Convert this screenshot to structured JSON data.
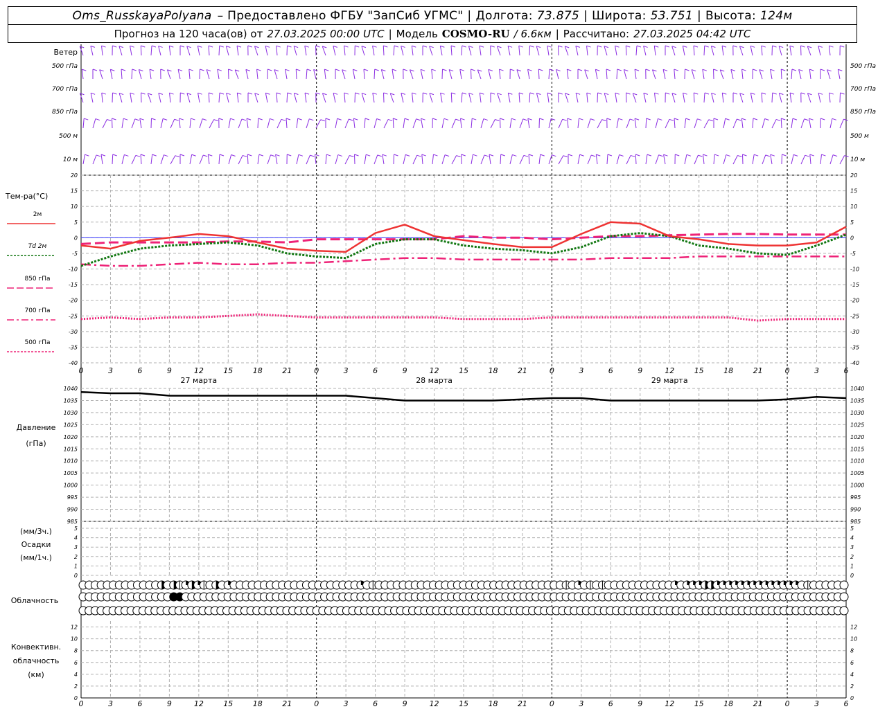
{
  "header": {
    "station": "Oms_RusskayaPolyana",
    "provided": "– Предоставлено ФГБУ \"ЗапСиб УГМС\"",
    "lon_label": "Долгота:",
    "lon": "73.875",
    "lat_label": "Широта:",
    "lat": "53.751",
    "alt_label": "Высота:",
    "alt": "124м",
    "forecast_label": "Прогноз на 120 часа(ов) от",
    "forecast_start": "27.03.2025 00:00 UTC",
    "model_label": "Модель",
    "model": "COSMO-RU",
    "resolution": "/ 6.6км",
    "calc_label": "Рассчитано:",
    "calc_time": "27.03.2025 04:42 UTC"
  },
  "chart_data": [
    {
      "type": "wind_barbs",
      "title": "Ветер",
      "levels": [
        "500 гПа",
        "700 гПа",
        "850 гПа",
        "500 м",
        "10 м"
      ]
    },
    {
      "type": "line",
      "ylabel": "Тем-ра(°C)",
      "ylim": [
        -40,
        20
      ],
      "yticks": [
        20,
        15,
        10,
        5,
        0,
        -5,
        -10,
        -15,
        -20,
        -25,
        -30,
        -35,
        -40
      ],
      "x_hours": [
        0,
        3,
        6,
        9,
        12,
        15,
        18,
        21,
        24,
        27,
        30,
        33,
        36,
        39,
        42,
        45,
        48,
        51,
        54,
        57,
        60,
        63,
        66,
        69,
        72,
        75,
        78
      ],
      "series": [
        {
          "name": "2м",
          "color": "#ee3333",
          "style": "solid",
          "values": [
            -2.5,
            -3.5,
            -1.0,
            0.0,
            1.2,
            0.5,
            -1.5,
            -3.5,
            -4.2,
            -4.5,
            1.5,
            4.2,
            0.5,
            -0.8,
            -2.0,
            -3.0,
            -3.0,
            1.2,
            5.0,
            4.5,
            0.5,
            -0.5,
            -2.0,
            -2.5,
            -2.5,
            -1.5,
            3.5
          ]
        },
        {
          "name": "Td 2м",
          "color": "#117711",
          "style": "dotted",
          "values": [
            -9.0,
            -6.0,
            -3.5,
            -2.5,
            -2.0,
            -1.5,
            -2.5,
            -5.0,
            -6.0,
            -6.5,
            -2.0,
            -0.5,
            -0.5,
            -2.5,
            -3.5,
            -4.0,
            -5.0,
            -3.0,
            0.5,
            1.5,
            0.5,
            -2.5,
            -3.5,
            -5.0,
            -5.5,
            -2.5,
            1.0
          ]
        },
        {
          "name": "850 гПа",
          "color": "#ee2277",
          "style": "dashed",
          "values": [
            -2.0,
            -1.5,
            -1.5,
            -1.5,
            -1.5,
            -1.2,
            -1.2,
            -1.5,
            -0.5,
            -0.5,
            -0.5,
            -0.5,
            -0.5,
            0.5,
            0.0,
            0.0,
            -0.5,
            0.0,
            0.5,
            0.5,
            0.8,
            1.0,
            1.2,
            1.2,
            1.0,
            1.0,
            1.0
          ]
        },
        {
          "name": "700 гПа",
          "color": "#ee2277",
          "style": "dashdot",
          "values": [
            -8.5,
            -9.0,
            -9.0,
            -8.5,
            -8.0,
            -8.5,
            -8.5,
            -8.0,
            -8.0,
            -7.5,
            -7.0,
            -6.5,
            -6.5,
            -7.0,
            -7.0,
            -7.0,
            -7.0,
            -7.0,
            -6.5,
            -6.5,
            -6.5,
            -6.0,
            -6.0,
            -6.0,
            -6.0,
            -6.0,
            -6.0
          ]
        },
        {
          "name": "500 гПа",
          "color": "#ee2277",
          "style": "fine_dotted",
          "values": [
            -26.0,
            -25.5,
            -26.0,
            -25.5,
            -25.5,
            -25.0,
            -24.5,
            -25.0,
            -25.5,
            -25.5,
            -25.5,
            -25.5,
            -25.5,
            -26.0,
            -26.0,
            -26.0,
            -25.5,
            -25.5,
            -25.5,
            -25.5,
            -25.5,
            -25.5,
            -25.5,
            -26.5,
            -26.0,
            -26.0,
            -26.0
          ]
        }
      ]
    },
    {
      "type": "line",
      "ylabel": "Давление",
      "yunit": "(гПа)",
      "ylim": [
        985,
        1040
      ],
      "yticks": [
        1040,
        1035,
        1030,
        1025,
        1020,
        1015,
        1010,
        1005,
        1000,
        995,
        990,
        985
      ],
      "x_hours": [
        0,
        3,
        6,
        9,
        12,
        15,
        18,
        21,
        24,
        27,
        30,
        33,
        36,
        39,
        42,
        45,
        48,
        51,
        54,
        57,
        60,
        63,
        66,
        69,
        72,
        75,
        78
      ],
      "series": [
        {
          "name": "",
          "color": "#000000",
          "style": "solid",
          "values": [
            1038.5,
            1038.0,
            1038.0,
            1037.0,
            1037.0,
            1037.0,
            1037.0,
            1037.0,
            1037.0,
            1037.0,
            1036.0,
            1035.0,
            1035.0,
            1035.0,
            1035.0,
            1035.5,
            1036.0,
            1036.0,
            1035.0,
            1035.0,
            1035.0,
            1035.0,
            1035.0,
            1035.0,
            1035.5,
            1036.5,
            1036.0
          ]
        }
      ]
    },
    {
      "type": "bar",
      "ylabel_top": "(мм/3ч.)",
      "ylabel": "Осадки",
      "ylabel_bottom": "(мм/1ч.)",
      "ylim": [
        0,
        5
      ],
      "yticks": [
        5,
        4,
        3,
        2,
        1,
        0
      ],
      "values": []
    },
    {
      "type": "cloud_cover",
      "ylabel": "Облачность",
      "rows": [
        "0000000000000303123210302000000000000000000000201000000000000000000000000000000010201010000000000020222332222222222222201000000",
        "0000000000000004400000000000000000000000000000000000000000000000000000000000000000000000000000000000000000000000000000000000000",
        "00000000000000000000000000000000000000000000000000000000000000000000000000000000000000000000000000000000000000000000000000000000"
      ]
    },
    {
      "type": "line",
      "ylabel": "Конвективн.",
      "ylabel2": "облачность",
      "yunit": "(км)",
      "ylim": [
        0,
        13
      ],
      "yticks": [
        12,
        10,
        8,
        6,
        4,
        2,
        0
      ],
      "values": []
    }
  ],
  "x_axis": {
    "tick_labels": [
      "0",
      "3",
      "6",
      "9",
      "12",
      "15",
      "18",
      "21",
      "0",
      "3",
      "6",
      "9",
      "12",
      "15",
      "18",
      "21",
      "0",
      "3",
      "6",
      "9",
      "12",
      "15",
      "18",
      "21",
      "0",
      "3",
      "6"
    ],
    "day_labels": [
      "27 марта",
      "28 марта",
      "29 марта"
    ]
  },
  "colors": {
    "wind": "#8a2be2",
    "grid": "#b0b0b0",
    "zero_line": "#3333ff"
  }
}
